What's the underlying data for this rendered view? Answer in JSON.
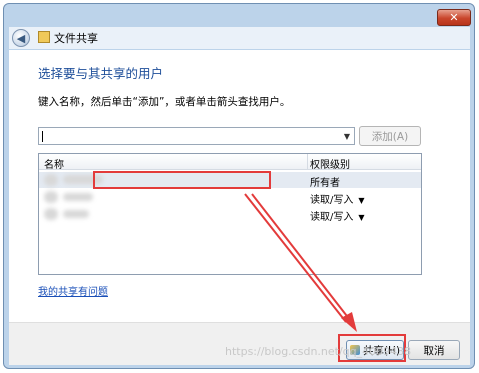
{
  "window": {
    "title": "文件共享",
    "close_glyph": "✕"
  },
  "main": {
    "heading": "选择要与其共享的用户",
    "instruction": "键入名称，然后单击“添加”，或者单击箭头查找用户。",
    "add_button": "添加(A)",
    "columns": [
      "名称",
      "权限级别"
    ],
    "rows": [
      {
        "name": "",
        "permission": "所有者",
        "has_dropdown": false
      },
      {
        "name": "",
        "permission": "读取/写入",
        "has_dropdown": true
      },
      {
        "name": "",
        "permission": "读取/写入",
        "has_dropdown": true
      }
    ],
    "link": "我的共享有问题"
  },
  "footer": {
    "share_button": "共享(H)",
    "cancel_button": "取消"
  },
  "watermark": "https://blog.csdn.net/qq_4009438",
  "colors": {
    "heading": "#1f4f9a",
    "annotation": "#e33b3b",
    "link": "#1a4fb8"
  }
}
